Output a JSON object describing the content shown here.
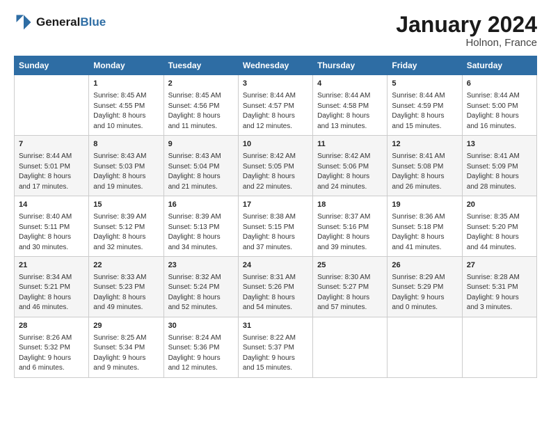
{
  "header": {
    "logo_line1": "General",
    "logo_line2": "Blue",
    "main_title": "January 2024",
    "subtitle": "Holnon, France"
  },
  "columns": [
    "Sunday",
    "Monday",
    "Tuesday",
    "Wednesday",
    "Thursday",
    "Friday",
    "Saturday"
  ],
  "weeks": [
    [
      {
        "day": "",
        "info": ""
      },
      {
        "day": "1",
        "info": "Sunrise: 8:45 AM\nSunset: 4:55 PM\nDaylight: 8 hours\nand 10 minutes."
      },
      {
        "day": "2",
        "info": "Sunrise: 8:45 AM\nSunset: 4:56 PM\nDaylight: 8 hours\nand 11 minutes."
      },
      {
        "day": "3",
        "info": "Sunrise: 8:44 AM\nSunset: 4:57 PM\nDaylight: 8 hours\nand 12 minutes."
      },
      {
        "day": "4",
        "info": "Sunrise: 8:44 AM\nSunset: 4:58 PM\nDaylight: 8 hours\nand 13 minutes."
      },
      {
        "day": "5",
        "info": "Sunrise: 8:44 AM\nSunset: 4:59 PM\nDaylight: 8 hours\nand 15 minutes."
      },
      {
        "day": "6",
        "info": "Sunrise: 8:44 AM\nSunset: 5:00 PM\nDaylight: 8 hours\nand 16 minutes."
      }
    ],
    [
      {
        "day": "7",
        "info": "Sunrise: 8:44 AM\nSunset: 5:01 PM\nDaylight: 8 hours\nand 17 minutes."
      },
      {
        "day": "8",
        "info": "Sunrise: 8:43 AM\nSunset: 5:03 PM\nDaylight: 8 hours\nand 19 minutes."
      },
      {
        "day": "9",
        "info": "Sunrise: 8:43 AM\nSunset: 5:04 PM\nDaylight: 8 hours\nand 21 minutes."
      },
      {
        "day": "10",
        "info": "Sunrise: 8:42 AM\nSunset: 5:05 PM\nDaylight: 8 hours\nand 22 minutes."
      },
      {
        "day": "11",
        "info": "Sunrise: 8:42 AM\nSunset: 5:06 PM\nDaylight: 8 hours\nand 24 minutes."
      },
      {
        "day": "12",
        "info": "Sunrise: 8:41 AM\nSunset: 5:08 PM\nDaylight: 8 hours\nand 26 minutes."
      },
      {
        "day": "13",
        "info": "Sunrise: 8:41 AM\nSunset: 5:09 PM\nDaylight: 8 hours\nand 28 minutes."
      }
    ],
    [
      {
        "day": "14",
        "info": "Sunrise: 8:40 AM\nSunset: 5:11 PM\nDaylight: 8 hours\nand 30 minutes."
      },
      {
        "day": "15",
        "info": "Sunrise: 8:39 AM\nSunset: 5:12 PM\nDaylight: 8 hours\nand 32 minutes."
      },
      {
        "day": "16",
        "info": "Sunrise: 8:39 AM\nSunset: 5:13 PM\nDaylight: 8 hours\nand 34 minutes."
      },
      {
        "day": "17",
        "info": "Sunrise: 8:38 AM\nSunset: 5:15 PM\nDaylight: 8 hours\nand 37 minutes."
      },
      {
        "day": "18",
        "info": "Sunrise: 8:37 AM\nSunset: 5:16 PM\nDaylight: 8 hours\nand 39 minutes."
      },
      {
        "day": "19",
        "info": "Sunrise: 8:36 AM\nSunset: 5:18 PM\nDaylight: 8 hours\nand 41 minutes."
      },
      {
        "day": "20",
        "info": "Sunrise: 8:35 AM\nSunset: 5:20 PM\nDaylight: 8 hours\nand 44 minutes."
      }
    ],
    [
      {
        "day": "21",
        "info": "Sunrise: 8:34 AM\nSunset: 5:21 PM\nDaylight: 8 hours\nand 46 minutes."
      },
      {
        "day": "22",
        "info": "Sunrise: 8:33 AM\nSunset: 5:23 PM\nDaylight: 8 hours\nand 49 minutes."
      },
      {
        "day": "23",
        "info": "Sunrise: 8:32 AM\nSunset: 5:24 PM\nDaylight: 8 hours\nand 52 minutes."
      },
      {
        "day": "24",
        "info": "Sunrise: 8:31 AM\nSunset: 5:26 PM\nDaylight: 8 hours\nand 54 minutes."
      },
      {
        "day": "25",
        "info": "Sunrise: 8:30 AM\nSunset: 5:27 PM\nDaylight: 8 hours\nand 57 minutes."
      },
      {
        "day": "26",
        "info": "Sunrise: 8:29 AM\nSunset: 5:29 PM\nDaylight: 9 hours\nand 0 minutes."
      },
      {
        "day": "27",
        "info": "Sunrise: 8:28 AM\nSunset: 5:31 PM\nDaylight: 9 hours\nand 3 minutes."
      }
    ],
    [
      {
        "day": "28",
        "info": "Sunrise: 8:26 AM\nSunset: 5:32 PM\nDaylight: 9 hours\nand 6 minutes."
      },
      {
        "day": "29",
        "info": "Sunrise: 8:25 AM\nSunset: 5:34 PM\nDaylight: 9 hours\nand 9 minutes."
      },
      {
        "day": "30",
        "info": "Sunrise: 8:24 AM\nSunset: 5:36 PM\nDaylight: 9 hours\nand 12 minutes."
      },
      {
        "day": "31",
        "info": "Sunrise: 8:22 AM\nSunset: 5:37 PM\nDaylight: 9 hours\nand 15 minutes."
      },
      {
        "day": "",
        "info": ""
      },
      {
        "day": "",
        "info": ""
      },
      {
        "day": "",
        "info": ""
      }
    ]
  ]
}
